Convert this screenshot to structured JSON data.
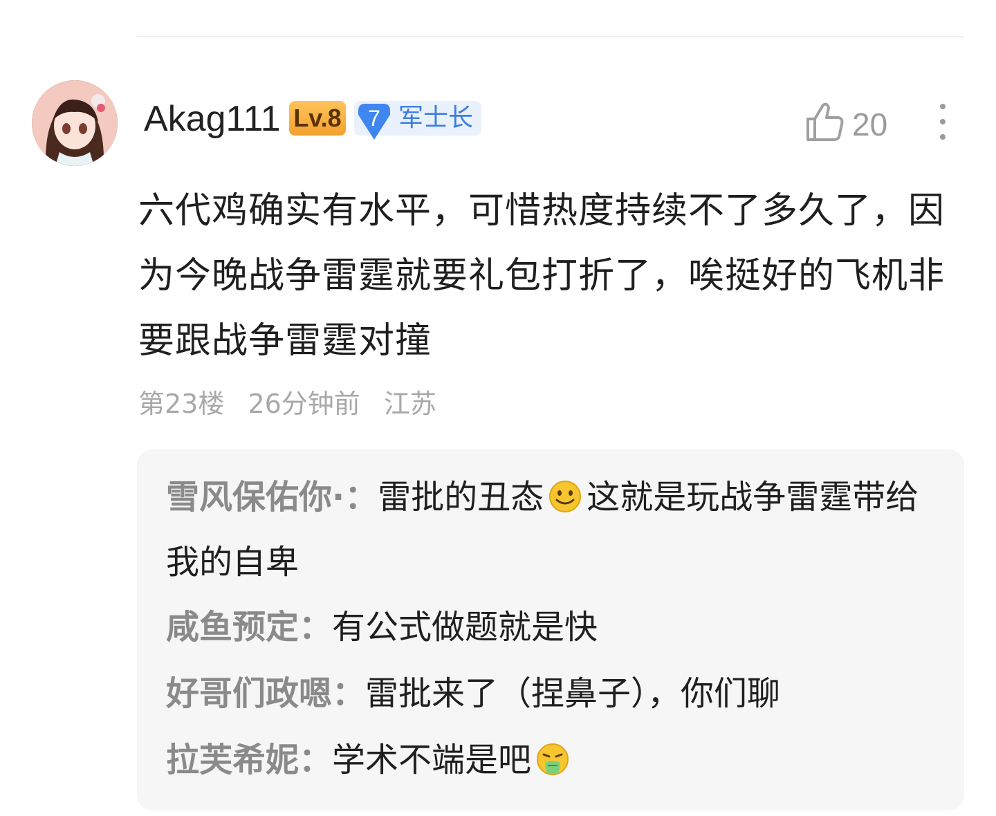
{
  "comment": {
    "username": "Akag111",
    "level_badge": "Lv.8",
    "rank_number": "7",
    "rank_title": "军士长",
    "like_count": "20",
    "text": "六代鸡确实有水平，可惜热度持续不了多久了，因为今晚战争雷霆就要礼包打折了，唉挺好的飞机非要跟战争雷霆对撞",
    "floor": "第23楼",
    "time": "26分钟前",
    "location": "江苏"
  },
  "replies": [
    {
      "author": "雪风保佑你·：",
      "text_before_emoji": "雷批的丑态",
      "emoji": "smile-emoji",
      "text_after_emoji": "这就是玩战争雷霆带给我的自卑"
    },
    {
      "author": "咸鱼预定：",
      "text": "有公式做题就是快"
    },
    {
      "author": "好哥们政嗯：",
      "text": "雷批来了（捏鼻子），你们聊"
    },
    {
      "author": "拉芙希妮：",
      "text": "学术不端是吧",
      "emoji": "vomit-emoji"
    }
  ],
  "colors": {
    "level_badge": "#f3a12e",
    "rank_badge_bg": "#e9f1fd",
    "rank_accent": "#3b7de0",
    "meta_text": "#a8a8a8",
    "reply_author": "#8a8a8a",
    "reply_bg": "#f6f6f6"
  }
}
